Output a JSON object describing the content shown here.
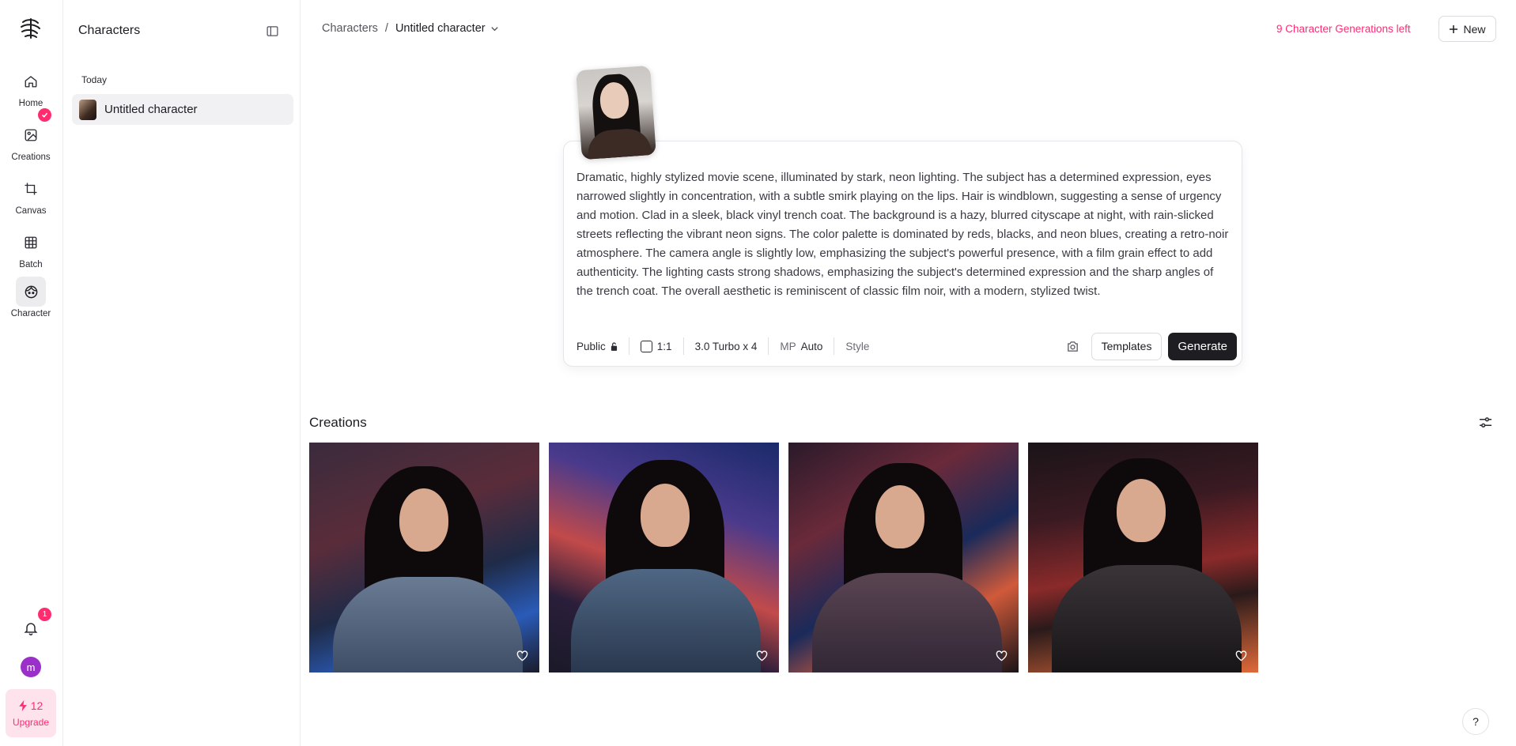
{
  "rail": {
    "items": [
      {
        "label": "Home",
        "icon": "home-icon"
      },
      {
        "label": "Creations",
        "icon": "image-icon"
      },
      {
        "label": "Canvas",
        "icon": "crop-icon"
      },
      {
        "label": "Batch",
        "icon": "grid-icon"
      },
      {
        "label": "Character",
        "icon": "face-icon"
      }
    ],
    "notification_count": "1",
    "avatar_letter": "m",
    "credits": "12",
    "upgrade_label": "Upgrade"
  },
  "panel": {
    "title": "Characters",
    "section": "Today",
    "items": [
      {
        "label": "Untitled character"
      }
    ]
  },
  "header": {
    "breadcrumb_root": "Characters",
    "breadcrumb_sep": "/",
    "breadcrumb_current": "Untitled character",
    "generations_left": "9 Character Generations left",
    "new_label": "New"
  },
  "prompt": {
    "text": "Dramatic, highly stylized movie scene, illuminated by stark, neon lighting. The subject has a determined expression, eyes narrowed slightly in concentration, with a subtle smirk playing on the lips. Hair is windblown, suggesting a sense of urgency and motion. Clad in a sleek, black vinyl trench coat. The background is a hazy, blurred cityscape at night, with rain-slicked streets reflecting the vibrant neon signs. The color palette is dominated by reds, blacks, and neon blues, creating a retro-noir atmosphere. The camera angle is slightly low, emphasizing the subject's powerful presence, with a film grain effect to add authenticity. The lighting casts strong shadows, emphasizing the subject's determined expression and the sharp angles of the trench coat. The overall aesthetic is reminiscent of classic film noir, with a modern, stylized twist.",
    "visibility": "Public",
    "aspect": "1:1",
    "model": "3.0 Turbo x 4",
    "mp_label": "MP",
    "mp_value": "Auto",
    "style_label": "Style",
    "templates_label": "Templates",
    "generate_label": "Generate"
  },
  "creations": {
    "title": "Creations"
  },
  "help_label": "?",
  "colors": {
    "accent": "#ff2d70",
    "generate_bg": "#1d1d22"
  }
}
